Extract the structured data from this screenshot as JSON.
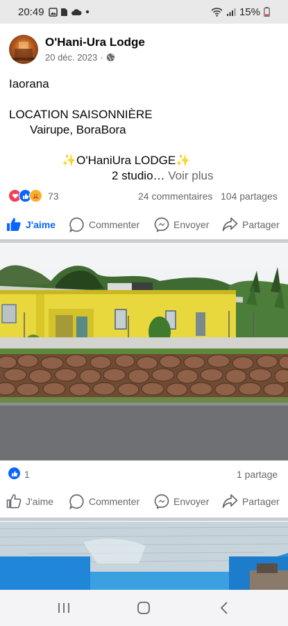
{
  "status_bar": {
    "time": "20:49",
    "battery": "15%",
    "icons": [
      "gallery-icon",
      "sim-icon",
      "cloud-icon",
      "dot-icon",
      "wifi-icon",
      "signal-icon",
      "battery-icon"
    ]
  },
  "post1": {
    "author": "O'Hani-Ura Lodge",
    "date": "20 déc. 2023",
    "privacy_icon": "globe-icon",
    "text": {
      "line1": "Iaorana",
      "line2": "LOCATION SAISONNIÈRE",
      "line3": "Vairupe, BoraBora",
      "line4": "✨O'HaniUra LODGE✨",
      "line5": "2 studio…",
      "see_more": "Voir plus"
    },
    "reactions": {
      "count": "73",
      "comments": "24 commentaires",
      "shares": "104 partages"
    },
    "actions": {
      "like": "J'aime",
      "comment": "Commenter",
      "send": "Envoyer",
      "share": "Partager"
    },
    "accent": "#0866ff"
  },
  "post2": {
    "like_count": "1",
    "shares": "1 partage",
    "actions": {
      "like": "J'aime",
      "comment": "Commenter",
      "send": "Envoyer",
      "share": "Partager"
    }
  }
}
